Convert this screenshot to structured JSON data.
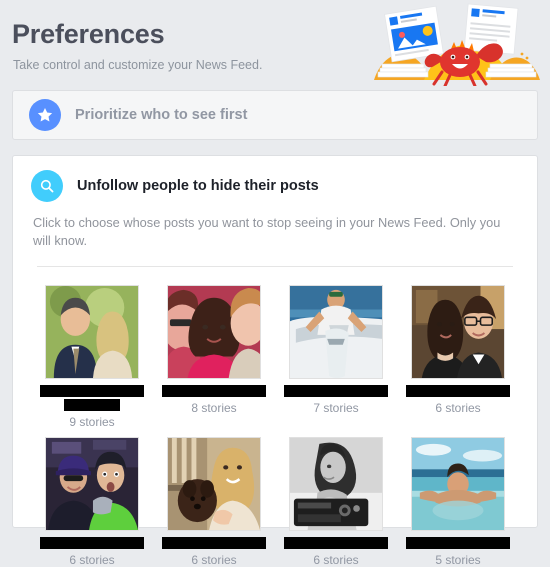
{
  "header": {
    "title": "Preferences",
    "subtitle": "Take control and customize your News Feed.",
    "illustration": "crab-with-news-articles-illustration"
  },
  "colors": {
    "page_background": "#e9ebee",
    "card_background": "#ffffff",
    "muted_card_background": "#f5f6f7",
    "star_icon_background": "#5890ff",
    "search_icon_background": "#41cdfc",
    "title_text": "#4b4f5c",
    "muted_text": "#90949c",
    "dark_text": "#1d2129",
    "redaction": "#000000"
  },
  "prioritize_card": {
    "icon": "star-icon",
    "label": "Prioritize who to see first"
  },
  "unfollow_card": {
    "icon": "search-icon",
    "label": "Unfollow people to hide their posts",
    "description": "Click to choose whose posts you want to stop seeing in your News Feed. Only you will know.",
    "people": [
      {
        "name_redacted": true,
        "name_lines": 2,
        "stories": "9 stories",
        "photo": "couple-outdoors-man-suit-woman-blonde"
      },
      {
        "name_redacted": true,
        "name_lines": 1,
        "stories": "8 stories",
        "photo": "three-women-selfie-pink-top"
      },
      {
        "name_redacted": true,
        "name_lines": 1,
        "stories": "7 stories",
        "photo": "man-on-boat-holding-large-fish"
      },
      {
        "name_redacted": true,
        "name_lines": 1,
        "stories": "6 stories",
        "photo": "couple-formal-event-glasses"
      },
      {
        "name_redacted": true,
        "name_lines": 1,
        "stories": "6 stories",
        "photo": "two-people-winter-hats-purple-green"
      },
      {
        "name_redacted": true,
        "name_lines": 1,
        "stories": "6 stories",
        "photo": "blonde-woman-holding-brown-dog"
      },
      {
        "name_redacted": true,
        "name_lines": 1,
        "stories": "6 stories",
        "photo": "black-and-white-woman-with-camera"
      },
      {
        "name_redacted": true,
        "name_lines": 1,
        "stories": "5 stories",
        "photo": "man-in-infinity-pool-ocean"
      }
    ]
  }
}
